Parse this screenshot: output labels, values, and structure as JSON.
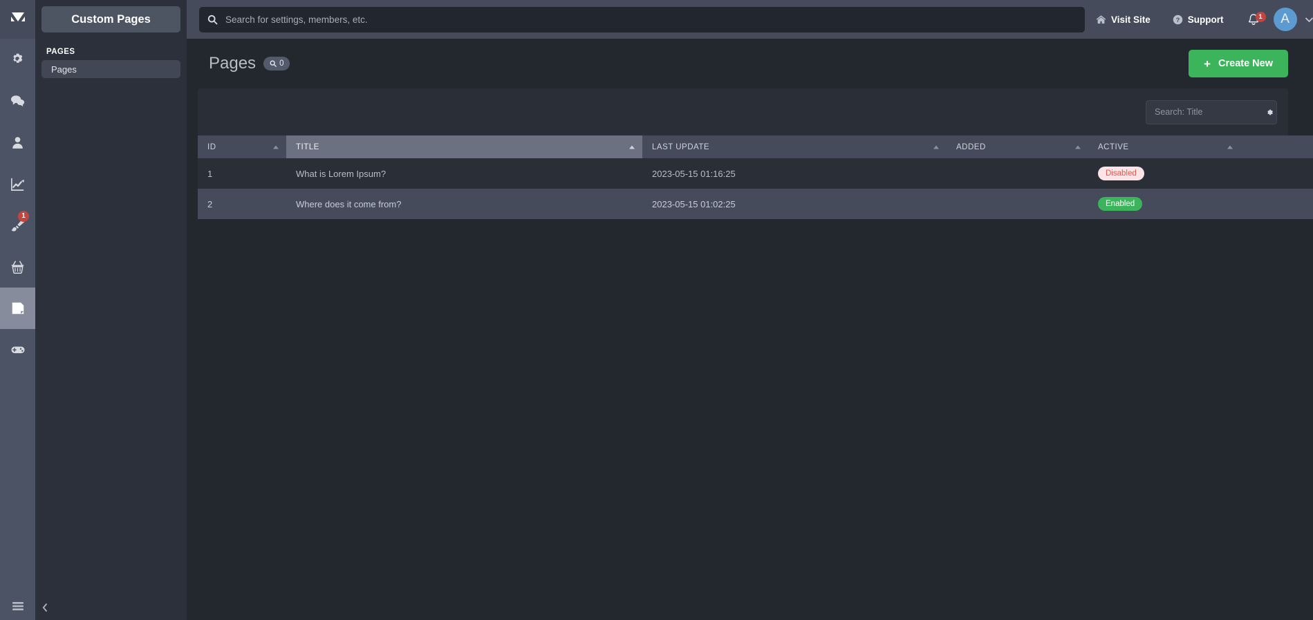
{
  "brand": {
    "logo_icon": "logo-triangle-m"
  },
  "icon_rail": {
    "items": [
      {
        "name": "settings-gear-icon",
        "badge": null,
        "active": false
      },
      {
        "name": "chat-bubbles-icon",
        "badge": null,
        "active": false
      },
      {
        "name": "user-icon",
        "badge": null,
        "active": false
      },
      {
        "name": "chart-line-icon",
        "badge": null,
        "active": false
      },
      {
        "name": "paint-brush-icon",
        "badge": "1",
        "active": false
      },
      {
        "name": "basket-icon",
        "badge": null,
        "active": false
      },
      {
        "name": "page-icon",
        "badge": null,
        "active": true
      },
      {
        "name": "gamepad-icon",
        "badge": null,
        "active": false
      }
    ],
    "bottom_icon": "hamburger-menu-icon"
  },
  "sidebar": {
    "title": "Custom Pages",
    "group_label": "PAGES",
    "items": [
      {
        "label": "Pages"
      }
    ],
    "collapse_icon": "chevron-left-icon"
  },
  "topbar": {
    "search": {
      "placeholder": "Search for settings, members, etc.",
      "value": "",
      "icon": "search-icon"
    },
    "visit_site": {
      "label": "Visit Site",
      "icon": "home-icon"
    },
    "support": {
      "label": "Support",
      "icon": "question-circle-icon"
    },
    "notifications": {
      "icon": "bell-icon",
      "count": "1"
    },
    "avatar": {
      "initial": "A"
    },
    "caret": "chevron-down-icon"
  },
  "page": {
    "title": "Pages",
    "badge": {
      "icon": "search-icon",
      "count": "0"
    },
    "create_button": {
      "label": "Create New",
      "icon": "plus-icon",
      "color": "#3cb45b"
    }
  },
  "table": {
    "filter": {
      "placeholder": "Search: Title",
      "value": "",
      "gear_icon": "gear-icon"
    },
    "columns": [
      {
        "key": "id",
        "label": "ID",
        "sorted": false
      },
      {
        "key": "title",
        "label": "TITLE",
        "sorted": true
      },
      {
        "key": "last_update",
        "label": "LAST UPDATE",
        "sorted": false
      },
      {
        "key": "added",
        "label": "ADDED",
        "sorted": false
      },
      {
        "key": "active",
        "label": "ACTIVE",
        "sorted": false
      },
      {
        "key": "actions",
        "label": "",
        "sorted": false
      }
    ],
    "rows": [
      {
        "id": "1",
        "title": "What is Lorem Ipsum?",
        "last_update": "2023-05-15 01:16:25",
        "added": "",
        "active": {
          "label": "Disabled",
          "state": "disabled"
        },
        "actions": [
          "view-icon",
          "edit-icon",
          "delete-icon"
        ]
      },
      {
        "id": "2",
        "title": "Where does it come from?",
        "last_update": "2023-05-15 01:02:25",
        "added": "",
        "active": {
          "label": "Enabled",
          "state": "enabled"
        },
        "actions": [
          "view-icon",
          "edit-icon",
          "delete-icon"
        ]
      }
    ]
  },
  "colors": {
    "rail": "#4c5364",
    "sidebar": "#2c303a",
    "topbar": "#454b5a",
    "main_bg": "#23272e",
    "accent_green": "#3cb45b",
    "badge_red": "#c4453f",
    "disabled_text": "#e0584f",
    "avatar_blue": "#5c9bd1"
  }
}
